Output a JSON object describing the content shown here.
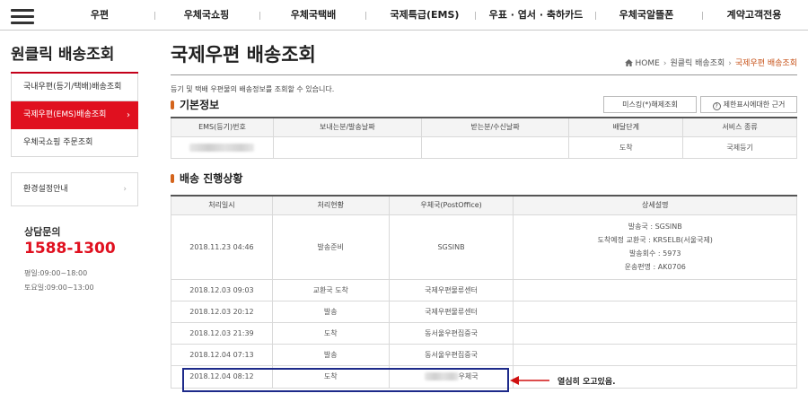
{
  "nav": {
    "items": [
      "우편",
      "우체국쇼핑",
      "우체국택배",
      "국제특급(EMS)",
      "우표 · 엽서 · 축하카드",
      "우체국알뜰폰",
      "계약고객전용"
    ],
    "menu_icon": "hamburger-menu-icon"
  },
  "sidebar": {
    "title": "원클릭 배송조회",
    "items": [
      "국내우편(등기/택배)배송조회",
      "국제우편(EMS)배송조회",
      "우체국쇼핑 주문조회"
    ],
    "active_arrow": "›",
    "env": "환경설정안내",
    "env_arrow": "›",
    "consult_title": "상담문의",
    "phone": "1588-1300",
    "hours": [
      "평일:09:00~18:00",
      "토요일:09:00~13:00"
    ]
  },
  "page": {
    "title": "국제우편 배송조회",
    "breadcrumb": [
      "HOME",
      "원클릭 배송조회",
      "국제우편 배송조회"
    ],
    "breadcrumb_sep": "›",
    "intro": "등기 및 택배 우편물의 배송정보를 조회할 수 있습니다."
  },
  "basic": {
    "section_title": "기본정보",
    "btn_missing": "미스킹(*)해제조회",
    "btn_limit": "제한표시에대한 근거",
    "headers": [
      "EMS(등기)번호",
      "보내는분/발송날짜",
      "받는분/수신날짜",
      "배달단계",
      "서비스 종류"
    ],
    "stage": "도착",
    "service": "국제등기"
  },
  "progress": {
    "section_title": "배송 진행상황",
    "headers": [
      "처리일시",
      "처리현황",
      "우체국(PostOffice)",
      "상세설명"
    ],
    "rows": [
      {
        "datetime": "2018.11.23 04:46",
        "status": "발송준비",
        "office": "SGSINB",
        "detail": [
          "발송국 : SGSINB",
          "도착예정 교환국 : KRSELB(서울국제)",
          "발송회수 : 5973",
          "운송편명 : AK0706"
        ]
      },
      {
        "datetime": "2018.12.03 09:03",
        "status": "교환국 도착",
        "office": "국제우편물류센터",
        "detail": []
      },
      {
        "datetime": "2018.12.03 20:12",
        "status": "발송",
        "office": "국제우편물류센터",
        "detail": []
      },
      {
        "datetime": "2018.12.03 21:39",
        "status": "도착",
        "office": "동서울우편집중국",
        "detail": []
      },
      {
        "datetime": "2018.12.04 07:13",
        "status": "발송",
        "office": "동서울우편집중국",
        "detail": []
      },
      {
        "datetime": "2018.12.04 08:12",
        "status": "도착",
        "office": "우체국",
        "detail": []
      }
    ]
  },
  "annotation": "열심히 오고있음."
}
